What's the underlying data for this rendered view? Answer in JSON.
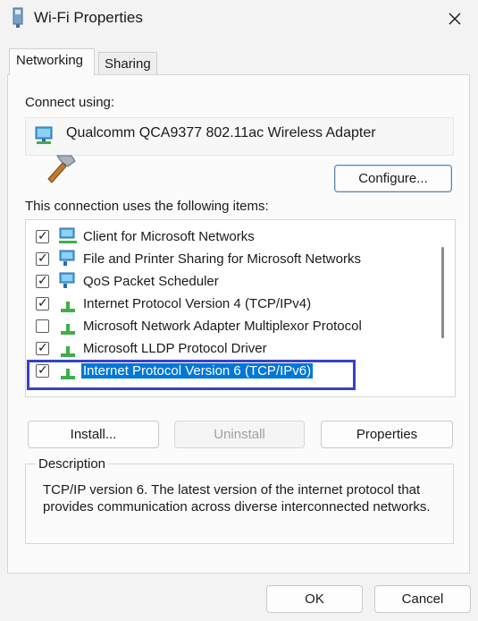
{
  "window": {
    "title": "Wi-Fi Properties"
  },
  "tabs": [
    {
      "label": "Networking"
    },
    {
      "label": "Sharing"
    }
  ],
  "connect_using_label": "Connect using:",
  "adapter_name": "Qualcomm QCA9377 802.11ac Wireless Adapter",
  "configure_label": "Configure...",
  "items_label": "This connection uses the following items:",
  "items": [
    {
      "label": "Client for Microsoft Networks",
      "checked": true,
      "icon": "network-client-icon"
    },
    {
      "label": "File and Printer Sharing for Microsoft Networks",
      "checked": true,
      "icon": "network-service-icon"
    },
    {
      "label": "QoS Packet Scheduler",
      "checked": true,
      "icon": "network-service-icon"
    },
    {
      "label": "Internet Protocol Version 4 (TCP/IPv4)",
      "checked": true,
      "icon": "protocol-icon"
    },
    {
      "label": "Microsoft Network Adapter Multiplexor Protocol",
      "checked": false,
      "icon": "protocol-icon"
    },
    {
      "label": "Microsoft LLDP Protocol Driver",
      "checked": true,
      "icon": "protocol-icon"
    },
    {
      "label": "Internet Protocol Version 6 (TCP/IPv6)",
      "checked": true,
      "icon": "protocol-icon",
      "selected": true
    }
  ],
  "buttons": {
    "install": "Install...",
    "uninstall": "Uninstall",
    "properties": "Properties",
    "ok": "OK",
    "cancel": "Cancel"
  },
  "description": {
    "title": "Description",
    "text": "TCP/IP version 6. The latest version of the internet protocol that provides communication across diverse interconnected networks."
  },
  "colors": {
    "selection": "#0078d7",
    "highlight_box": "#3543c8"
  }
}
